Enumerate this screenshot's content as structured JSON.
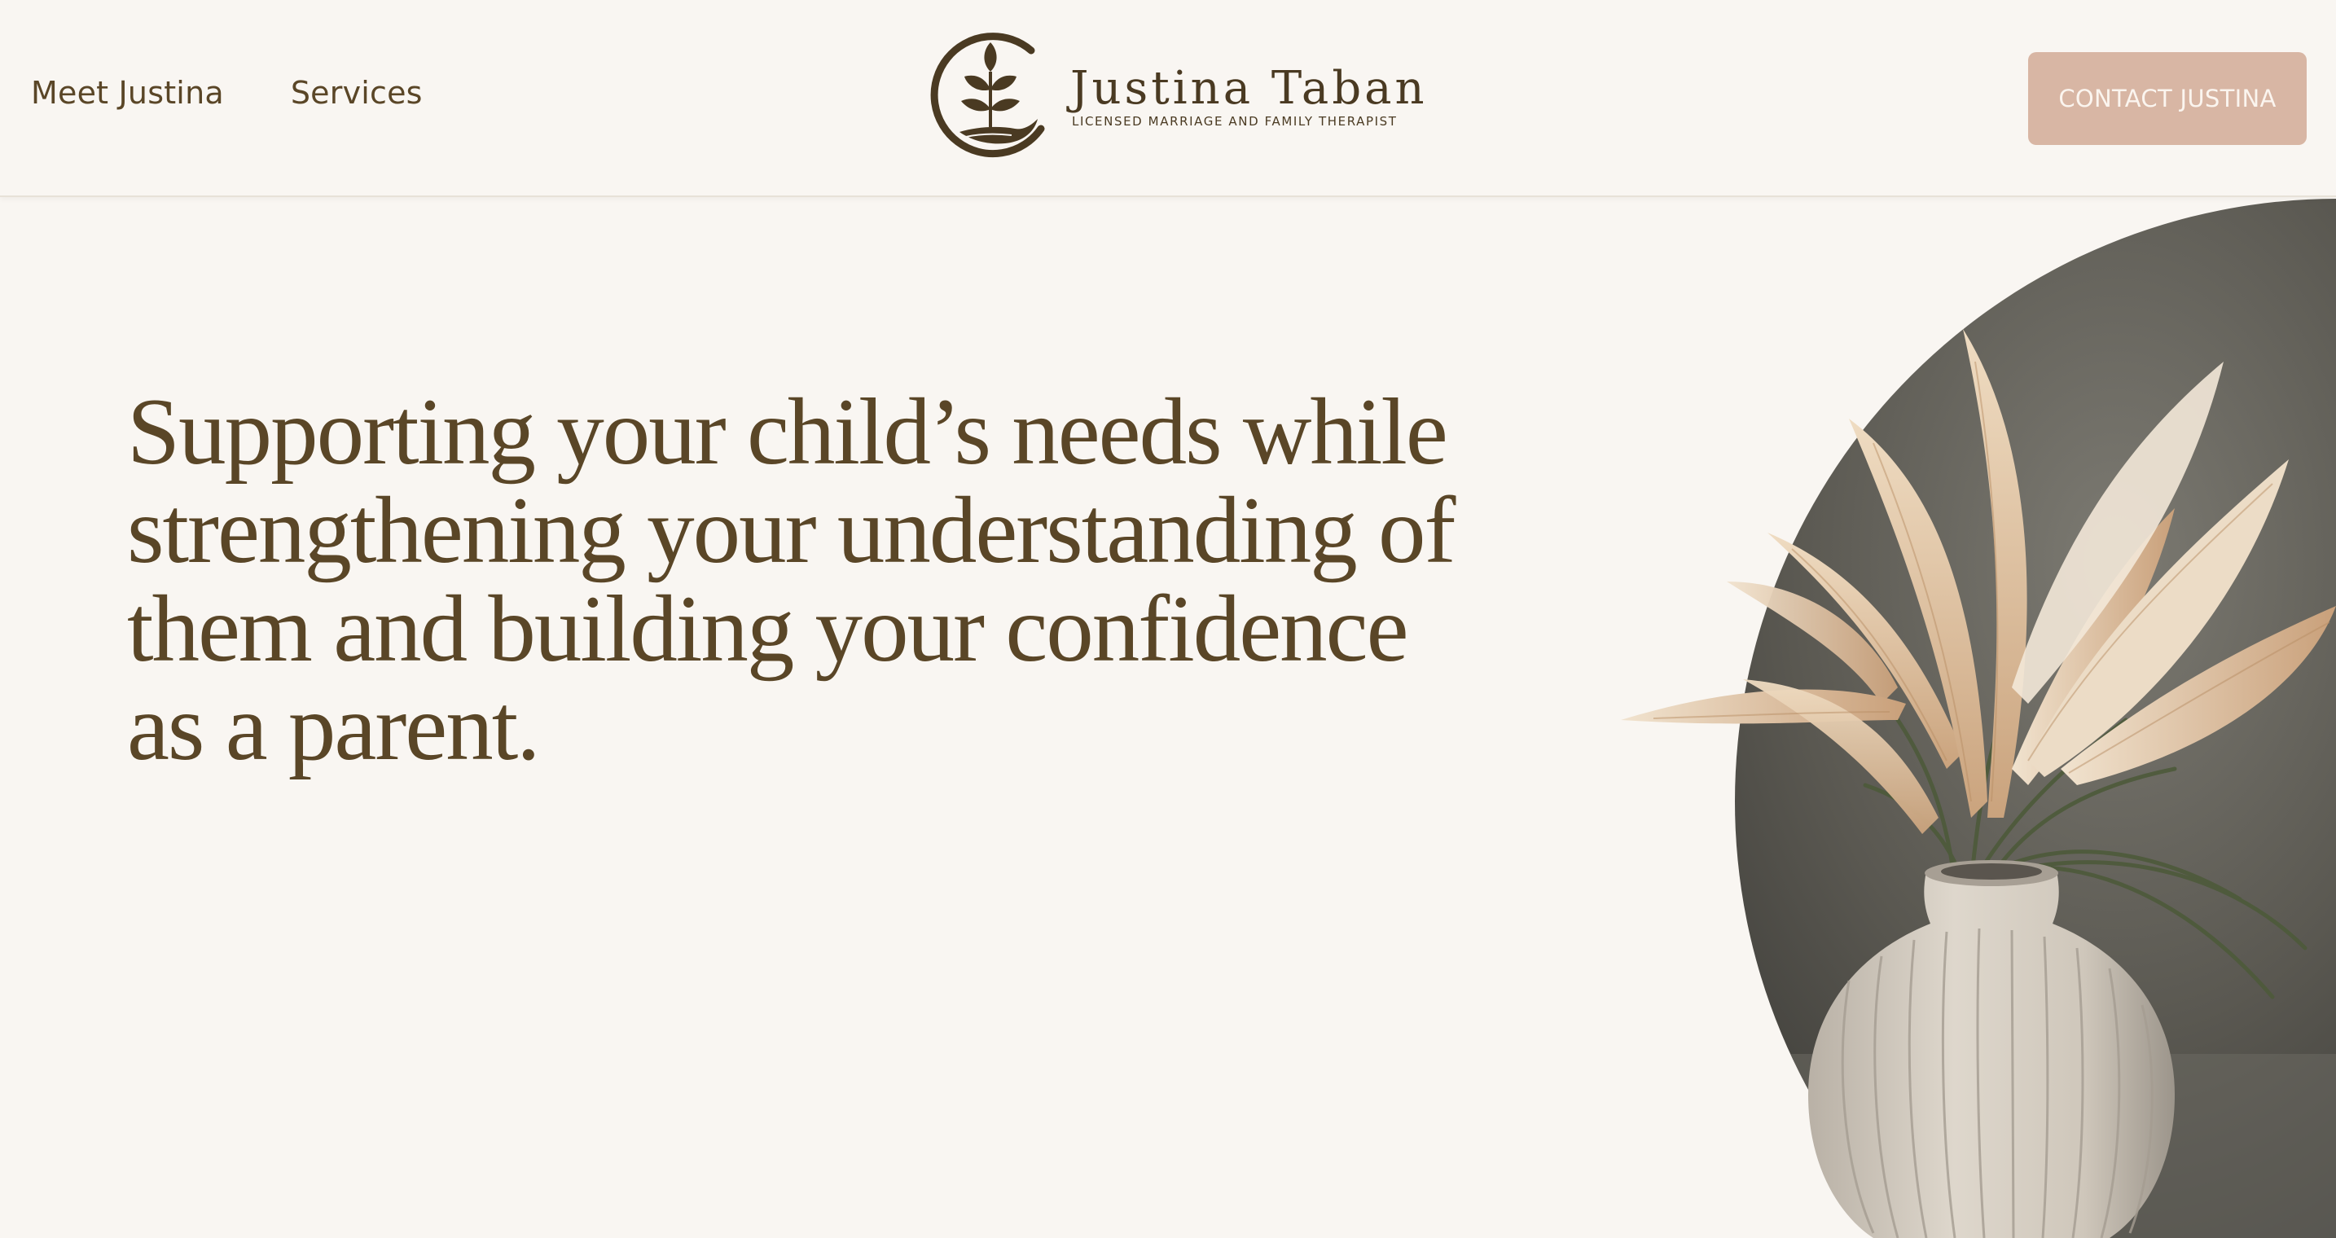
{
  "nav": {
    "items": [
      {
        "label": "Meet Justina"
      },
      {
        "label": "Services"
      }
    ]
  },
  "logo": {
    "name": "Justina Taban",
    "tagline": "LICENSED MARRIAGE AND FAMILY THERAPIST",
    "icon": "sprout-in-hand-icon"
  },
  "cta": {
    "label": "CONTACT JUSTINA"
  },
  "hero": {
    "heading": "Supporting your child’s needs while strengthening your understanding of them and building your confidence as a parent.",
    "image": "pampas-grass-vase-photo"
  },
  "colors": {
    "background": "#f9f6f2",
    "text": "#5a4627",
    "accent": "#d8b6a4",
    "logo": "#4a3a22"
  }
}
